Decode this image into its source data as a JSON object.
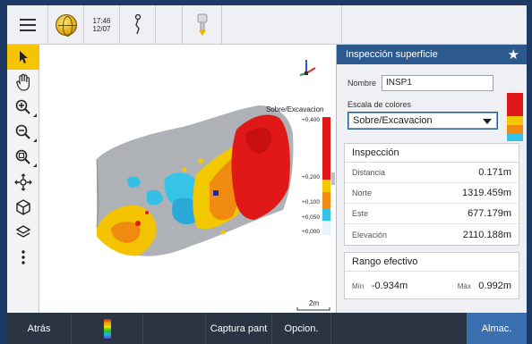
{
  "statusbar": {
    "time": "17:46",
    "date": "12/07"
  },
  "toolbar_left": {
    "items": [
      "select-tool",
      "pan-tool",
      "zoom-in-tool",
      "zoom-out-tool",
      "zoom-extents-tool",
      "orbit-tool",
      "cube-view-tool",
      "layers-tool",
      "more-tool"
    ]
  },
  "map": {
    "legend_title": "Sobre/Excavacion",
    "legend_ticks": [
      "+0,400",
      "+0,200",
      "+0,100",
      "+0,050",
      "+0,000"
    ],
    "scale_bar_label": "2m"
  },
  "panel": {
    "title": "Inspección superficie",
    "name_label": "Nombre",
    "name_value": "INSP1",
    "scale_label": "Escala de colores",
    "scale_value": "Sobre/Excavacion",
    "inspection_title": "Inspección",
    "inspection_rows": [
      {
        "label": "Distancia",
        "value": "0.171m"
      },
      {
        "label": "Norte",
        "value": "1319.459m"
      },
      {
        "label": "Este",
        "value": "677.179m"
      },
      {
        "label": "Elevación",
        "value": "2110.188m"
      }
    ],
    "range_title": "Rango efectivo",
    "range_min_label": "Mín",
    "range_min_value": "-0.934m",
    "range_max_label": "Máx",
    "range_max_value": "0.992m"
  },
  "bottombar": {
    "back": "Atrás",
    "capture": "Captura pant",
    "options": "Opcion.",
    "store": "Almac."
  },
  "colors": {
    "accent": "#2c5a8f",
    "active_tool": "#f6c400",
    "store_button": "#3a6fb0"
  }
}
